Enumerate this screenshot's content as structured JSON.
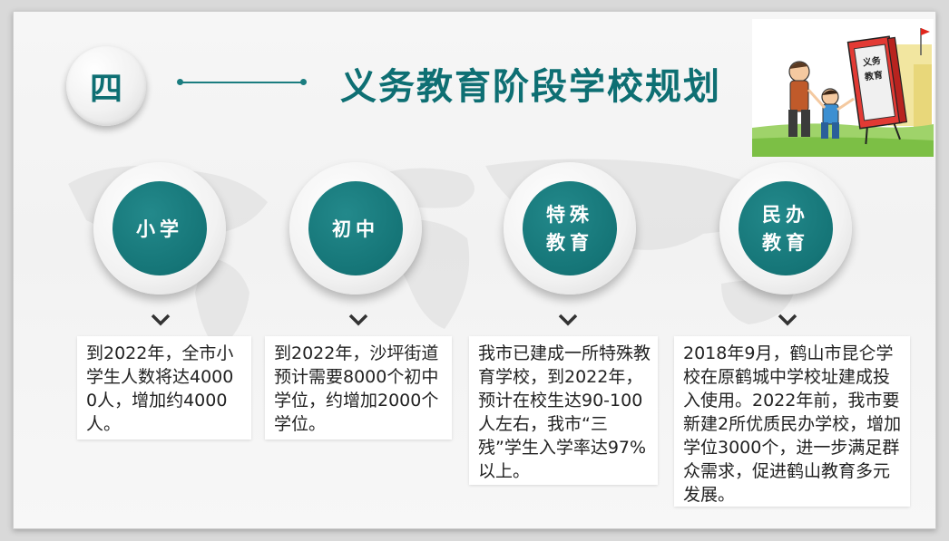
{
  "header": {
    "section_number": "四",
    "title": "义务教育阶段学校规划"
  },
  "illustration": {
    "book_text": "义务教育",
    "icon": "father-son-book-illustration"
  },
  "categories": [
    {
      "label": "小学",
      "text": "到2022年，全市小学生人数将达40000人，增加约4000人。"
    },
    {
      "label": "初中",
      "text": "到2022年，沙坪街道预计需要8000个初中学位，约增加2000个学位。"
    },
    {
      "label": "特殊\n教育",
      "text": "我市已建成一所特殊教育学校，到2022年，预计在校生达90-100人左右，我市“三残”学生入学率达97%以上。"
    },
    {
      "label": "民办\n教育",
      "text": "2018年9月，鹤山市昆仑学校在原鹤城中学校址建成投入使用。2022年前，我市要新建2所优质民办学校，增加学位3000个，进一步满足群众需求，促进鹤山教育多元发展。"
    }
  ],
  "colors": {
    "accent": "#0e6f73",
    "circle_fill": "#157577"
  }
}
